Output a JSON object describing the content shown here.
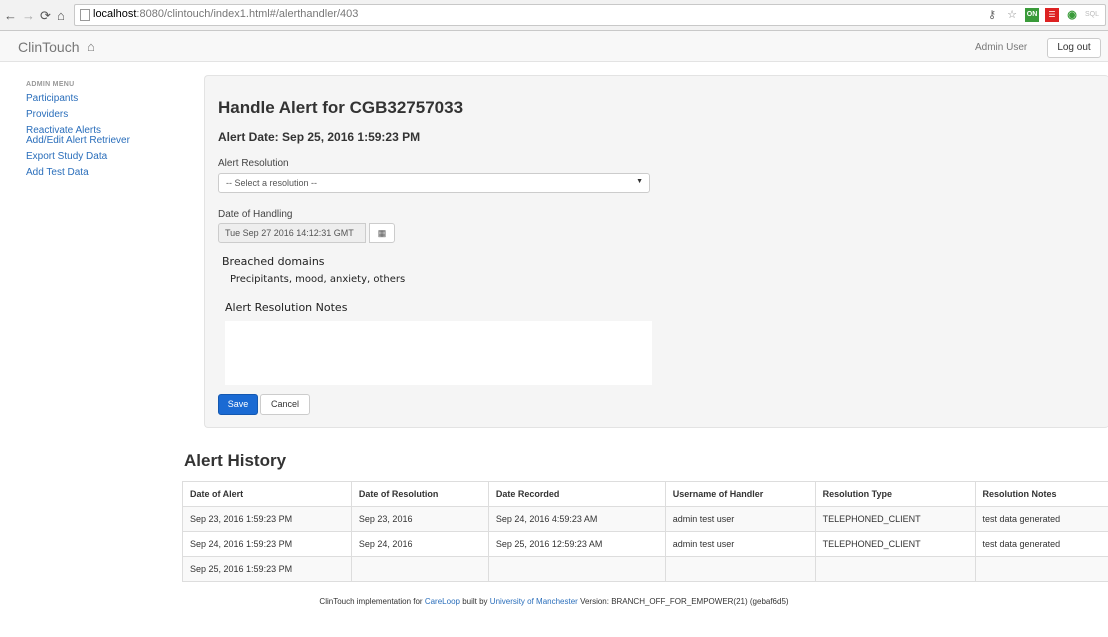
{
  "browser": {
    "url_host": "localhost",
    "url_path": ":8080/clintouch/index1.html#/alerthandler/403",
    "ext_on_label": "ON",
    "ext_sql_label": "SQL"
  },
  "navbar": {
    "brand": "ClinTouch",
    "user": "Admin User",
    "logout_label": "Log out"
  },
  "sidebar": {
    "title": "ADMIN MENU",
    "items": [
      {
        "label": "Participants"
      },
      {
        "label": "Providers"
      },
      {
        "label": "Reactivate Alerts"
      },
      {
        "label": "Add/Edit Alert Retriever"
      },
      {
        "label": "Export Study Data"
      },
      {
        "label": "Add Test Data"
      }
    ]
  },
  "alert": {
    "heading": "Handle Alert for CGB32757033",
    "date_line": "Alert Date: Sep 25, 2016 1:59:23 PM",
    "resolution_label": "Alert Resolution",
    "resolution_value": "-- Select a resolution --",
    "handling_label": "Date of Handling",
    "handling_value": "Tue Sep 27 2016 14:12:31 GMT",
    "breached_title": "Breached domains",
    "breached_values": "Precipitants, mood, anxiety, others",
    "notes_title": "Alert Resolution Notes",
    "notes_value": "",
    "save_label": "Save",
    "cancel_label": "Cancel"
  },
  "history": {
    "title": "Alert History",
    "columns": [
      "Date of Alert",
      "Date of Resolution",
      "Date Recorded",
      "Username of Handler",
      "Resolution Type",
      "Resolution Notes"
    ],
    "rows": [
      [
        "Sep 23, 2016 1:59:23 PM",
        "Sep 23, 2016",
        "Sep 24, 2016 4:59:23 AM",
        "admin test user",
        "TELEPHONED_CLIENT",
        "test data generated"
      ],
      [
        "Sep 24, 2016 1:59:23 PM",
        "Sep 24, 2016",
        "Sep 25, 2016 12:59:23 AM",
        "admin test user",
        "TELEPHONED_CLIENT",
        "test data generated"
      ],
      [
        "Sep 25, 2016 1:59:23 PM",
        "",
        "",
        "",
        "",
        ""
      ]
    ]
  },
  "footer": {
    "prefix": "ClinTouch implementation for",
    "link1": "CareLoop",
    "middle": "built by",
    "link2": "University of Manchester",
    "suffix": "Version: BRANCH_OFF_FOR_EMPOWER(21) (gebaf6d5)"
  },
  "colors": {
    "link": "#2a6ebb",
    "primary_button": "#1a6ad3"
  },
  "icons": [
    "back-icon",
    "forward-icon",
    "reload-icon",
    "home-icon",
    "page-icon",
    "calendar-icon",
    "caret-down-icon"
  ]
}
